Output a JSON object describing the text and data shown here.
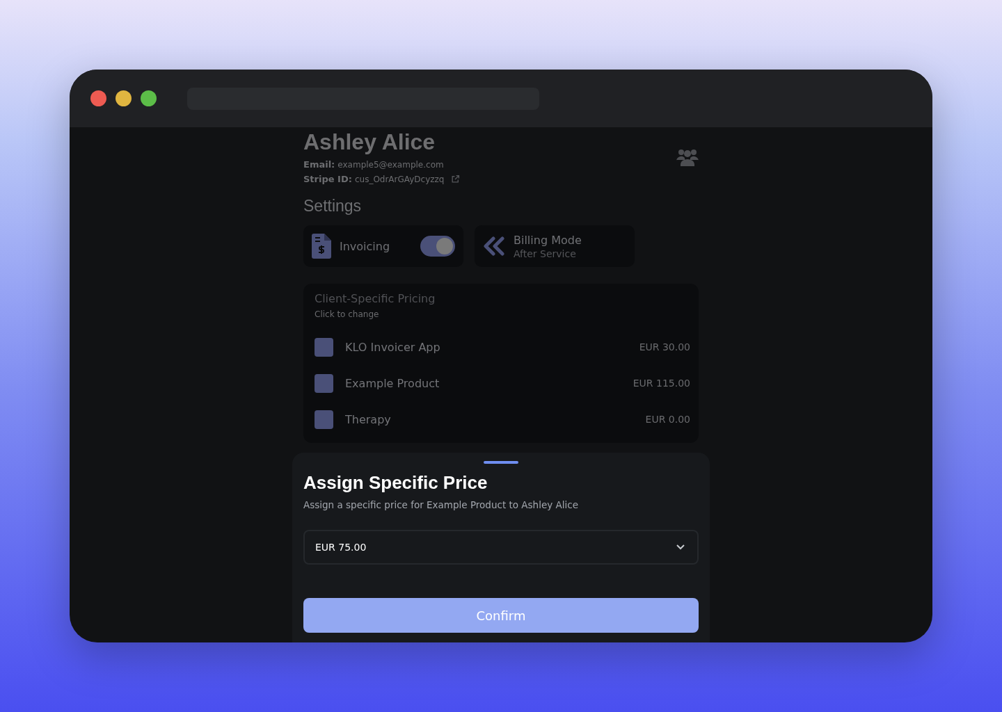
{
  "client": {
    "name": "Ashley Alice",
    "email_label": "Email:",
    "email": "example5@example.com",
    "stripe_label": "Stripe ID:",
    "stripe_id": "cus_OdrArGAyDcyzzq"
  },
  "settings": {
    "title": "Settings",
    "invoicing": {
      "label": "Invoicing",
      "on": true
    },
    "billing_mode": {
      "label": "Billing Mode",
      "value": "After Service"
    }
  },
  "pricing": {
    "title": "Client-Specific Pricing",
    "hint": "Click to change",
    "items": [
      {
        "name": "KLO Invoicer App",
        "price": "EUR 30.00",
        "checked": false
      },
      {
        "name": "Example Product",
        "price": "EUR 115.00",
        "checked": false
      },
      {
        "name": "Therapy",
        "price": "EUR 0.00",
        "checked": false
      }
    ]
  },
  "sheet": {
    "title": "Assign Specific Price",
    "subtitle": "Assign a specific price for Example Product to Ashley Alice",
    "select_value": "EUR 75.00",
    "confirm": "Confirm"
  }
}
